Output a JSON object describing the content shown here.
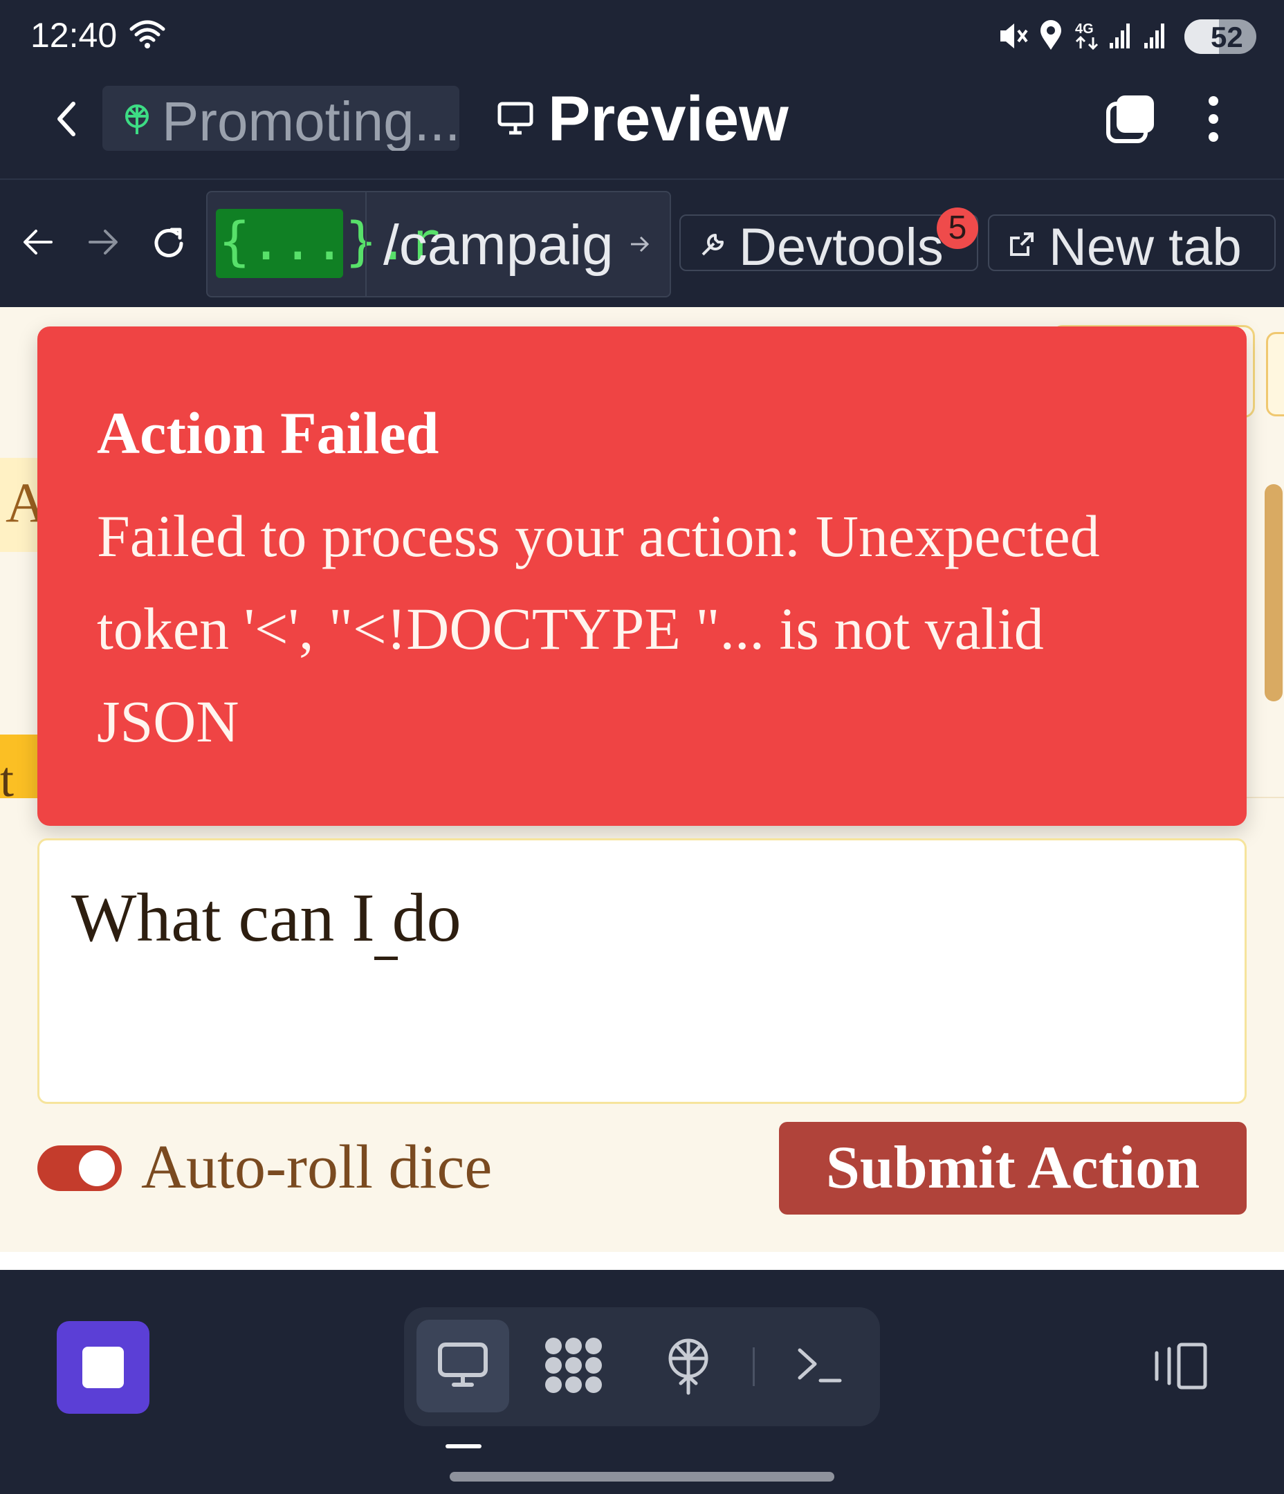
{
  "status_bar": {
    "time": "12:40",
    "battery": "52"
  },
  "app_bar": {
    "project_title": "Promoting...",
    "mode_title": "Preview"
  },
  "browser": {
    "url_host": "{...}.r",
    "url_path": "/campaig",
    "devtools_label": "Devtools",
    "devtools_badge": "5",
    "new_tab_label": "New tab"
  },
  "page": {
    "strip_letter": "A",
    "strip_letter_2": "t",
    "toast": {
      "title": "Action Failed",
      "message": "Failed to process your action: Unexpected token '<', \"<!DOCTYPE \"... is not valid JSON"
    },
    "action_input": {
      "value": "What can I do"
    },
    "auto_roll": {
      "label": "Auto-roll dice",
      "enabled": true
    },
    "submit_label": "Submit Action"
  },
  "colors": {
    "toast_bg": "#ef4444",
    "submit_bg": "#b0433a",
    "toggle_on": "#c43c2c",
    "page_bg": "#fbf6ea",
    "chrome_bg": "#1e2435",
    "stop_button": "#5b3fd6"
  },
  "icons": [
    "wifi-icon",
    "mute-icon",
    "location-icon",
    "network-4g-icon",
    "signal-icon",
    "battery-icon",
    "back-chevron-icon",
    "project-icon",
    "monitor-icon",
    "tabs-icon",
    "more-icon",
    "back-arrow-icon",
    "forward-arrow-icon",
    "reload-icon",
    "wrench-icon",
    "external-link-icon",
    "stop-icon",
    "desktop-icon",
    "apps-grid-icon",
    "globe-icon",
    "terminal-icon",
    "device-toggle-icon"
  ]
}
